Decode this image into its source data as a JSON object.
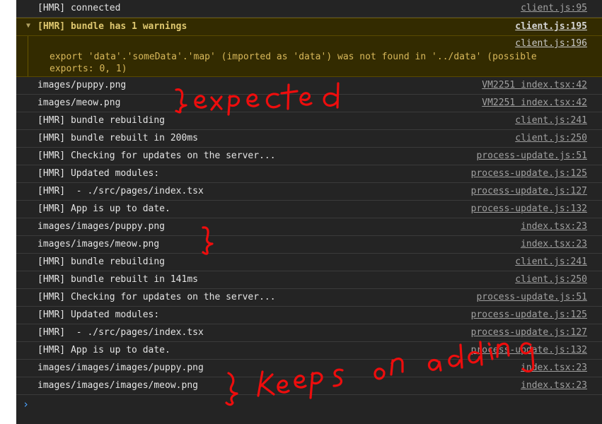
{
  "rows_top": [
    {
      "msg": "[HMR] connected",
      "src": "client.js:95"
    }
  ],
  "warning": {
    "msg": "[HMR] bundle has 1 warnings",
    "src": "client.js:195",
    "body_src": "client.js:196",
    "text": "export 'data'.'someData'.'map' (imported as 'data') was not found in '../data' (possible exports: 0, 1)"
  },
  "rows": [
    {
      "msg": "images/puppy.png",
      "src": "VM2251 index.tsx:42"
    },
    {
      "msg": "images/meow.png",
      "src": "VM2251 index.tsx:42"
    },
    {
      "msg": "[HMR] bundle rebuilding",
      "src": "client.js:241"
    },
    {
      "msg": "[HMR] bundle rebuilt in 200ms",
      "src": "client.js:250"
    },
    {
      "msg": "[HMR] Checking for updates on the server...",
      "src": "process-update.js:51"
    },
    {
      "msg": "[HMR] Updated modules:",
      "src": "process-update.js:125"
    },
    {
      "msg": "[HMR]  - ./src/pages/index.tsx",
      "src": "process-update.js:127"
    },
    {
      "msg": "[HMR] App is up to date.",
      "src": "process-update.js:132"
    },
    {
      "msg": "images/images/puppy.png",
      "src": "index.tsx:23"
    },
    {
      "msg": "images/images/meow.png",
      "src": "index.tsx:23"
    },
    {
      "msg": "[HMR] bundle rebuilding",
      "src": "client.js:241"
    },
    {
      "msg": "[HMR] bundle rebuilt in 141ms",
      "src": "client.js:250"
    },
    {
      "msg": "[HMR] Checking for updates on the server...",
      "src": "process-update.js:51"
    },
    {
      "msg": "[HMR] Updated modules:",
      "src": "process-update.js:125"
    },
    {
      "msg": "[HMR]  - ./src/pages/index.tsx",
      "src": "process-update.js:127"
    },
    {
      "msg": "[HMR] App is up to date.",
      "src": "process-update.js:132"
    },
    {
      "msg": "images/images/images/puppy.png",
      "src": "index.tsx:23"
    },
    {
      "msg": "images/images/images/meow.png",
      "src": "index.tsx:23"
    }
  ],
  "prompt_icon": "chevron-right-icon",
  "annotations": {
    "color": "#ee0d0d",
    "expected": "} expected",
    "keeps_adding": "} keeps on adding"
  }
}
